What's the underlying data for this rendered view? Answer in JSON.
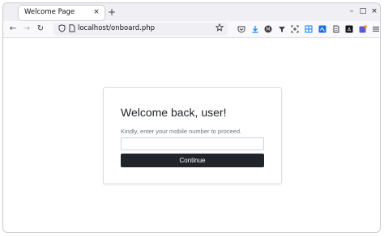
{
  "browser": {
    "tab": {
      "title": "Welcome Page",
      "close_glyph": "×"
    },
    "new_tab_glyph": "+",
    "window_controls": {
      "minimize": "–",
      "maximize": "□",
      "close": "×"
    },
    "nav": {
      "back": "←",
      "forward": "→",
      "reload": "↻"
    },
    "url": "localhost/onboard.php",
    "toolbar_icons": [
      "pocket-icon",
      "download-icon",
      "account-icon",
      "extension-icon",
      "screenshot-icon",
      "bookmarks-icon",
      "sidebar-icon",
      "reader-icon",
      "addon-icon",
      "puzzle-icon",
      "menu-icon"
    ]
  },
  "page": {
    "heading": "Welcome back, user!",
    "prompt": "Kindly, enter your mobile number to proceed.",
    "mobile_input": {
      "value": "",
      "placeholder": ""
    },
    "continue_label": "Continue"
  },
  "colors": {
    "button_bg": "#212529",
    "tab_strip_bg": "#f0f0f4",
    "text_muted": "#6c757d"
  }
}
